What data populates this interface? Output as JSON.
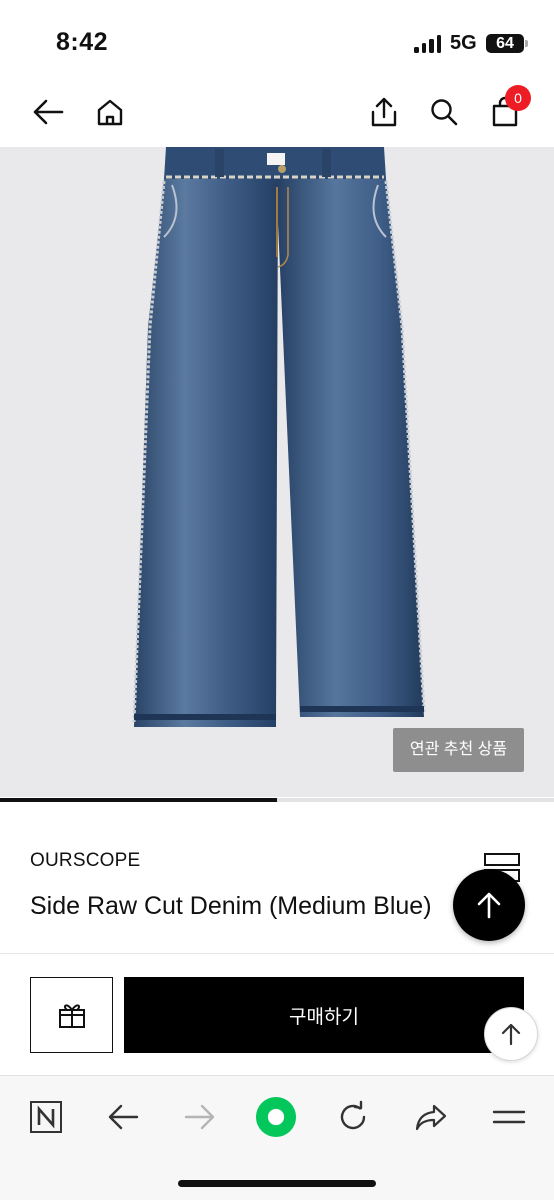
{
  "status_bar": {
    "time": "8:42",
    "network": "5G",
    "battery": "64"
  },
  "nav": {
    "icons": [
      "back-arrow-icon",
      "home-icon",
      "share-icon",
      "search-icon",
      "shopping-bag-icon"
    ],
    "cart_count": "0"
  },
  "product_image": {
    "subject": "jeans-image",
    "related_label": "연관 추천 상품",
    "carousel_progress": 0.5
  },
  "product": {
    "brand": "OURSCOPE",
    "name": "Side Raw Cut Denim (Medium Blue)"
  },
  "actions": {
    "buy_label": "구매하기",
    "gift_icon": "gift-icon"
  },
  "browser_toolbar": {
    "icons": [
      "naver-n-icon",
      "back-icon",
      "forward-icon",
      "green-dot-icon",
      "reload-icon",
      "share-arrow-icon",
      "menu-icon"
    ]
  },
  "colors": {
    "badge": "#ee1c25",
    "accent_green": "#03c75a",
    "denim": "#2f4e78"
  }
}
